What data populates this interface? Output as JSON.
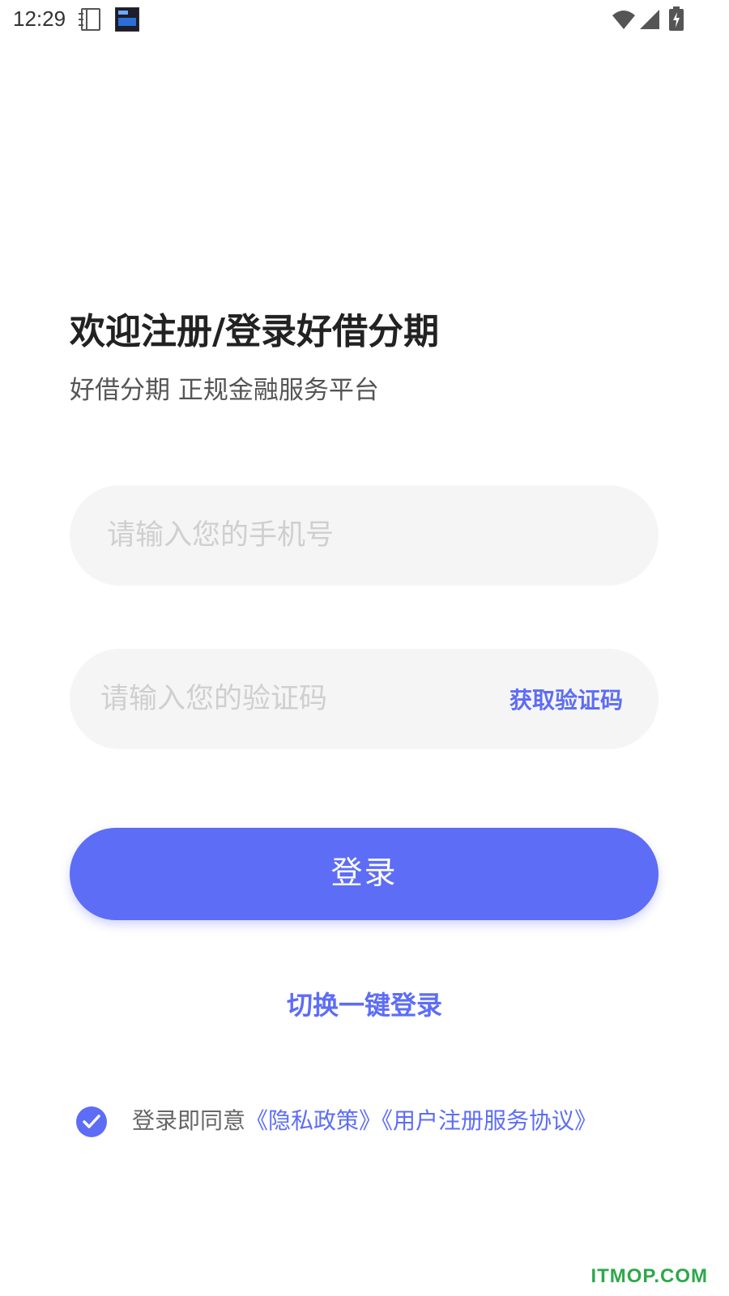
{
  "status_bar": {
    "time": "12:29"
  },
  "header": {
    "title": "欢迎注册/登录好借分期",
    "subtitle": "好借分期 正规金融服务平台"
  },
  "phone_field": {
    "placeholder": "请输入您的手机号",
    "value": ""
  },
  "code_field": {
    "placeholder": "请输入您的验证码",
    "value": "",
    "get_code_label": "获取验证码"
  },
  "login_button_label": "登录",
  "switch_login_label": "切换一键登录",
  "agreement": {
    "checked": true,
    "prefix": "登录即同意",
    "privacy_link": "《隐私政策》",
    "terms_link": "《用户注册服务协议》"
  },
  "watermark": "ITMOP.COM",
  "colors": {
    "accent": "#5d6df6",
    "field_bg": "#f5f5f5",
    "title": "#222222",
    "subtitle": "#555555"
  },
  "icons": {
    "status": [
      "notification-book-icon",
      "notification-app-icon",
      "wifi-icon",
      "signal-icon",
      "battery-charging-icon"
    ],
    "agreement": "check-icon"
  }
}
